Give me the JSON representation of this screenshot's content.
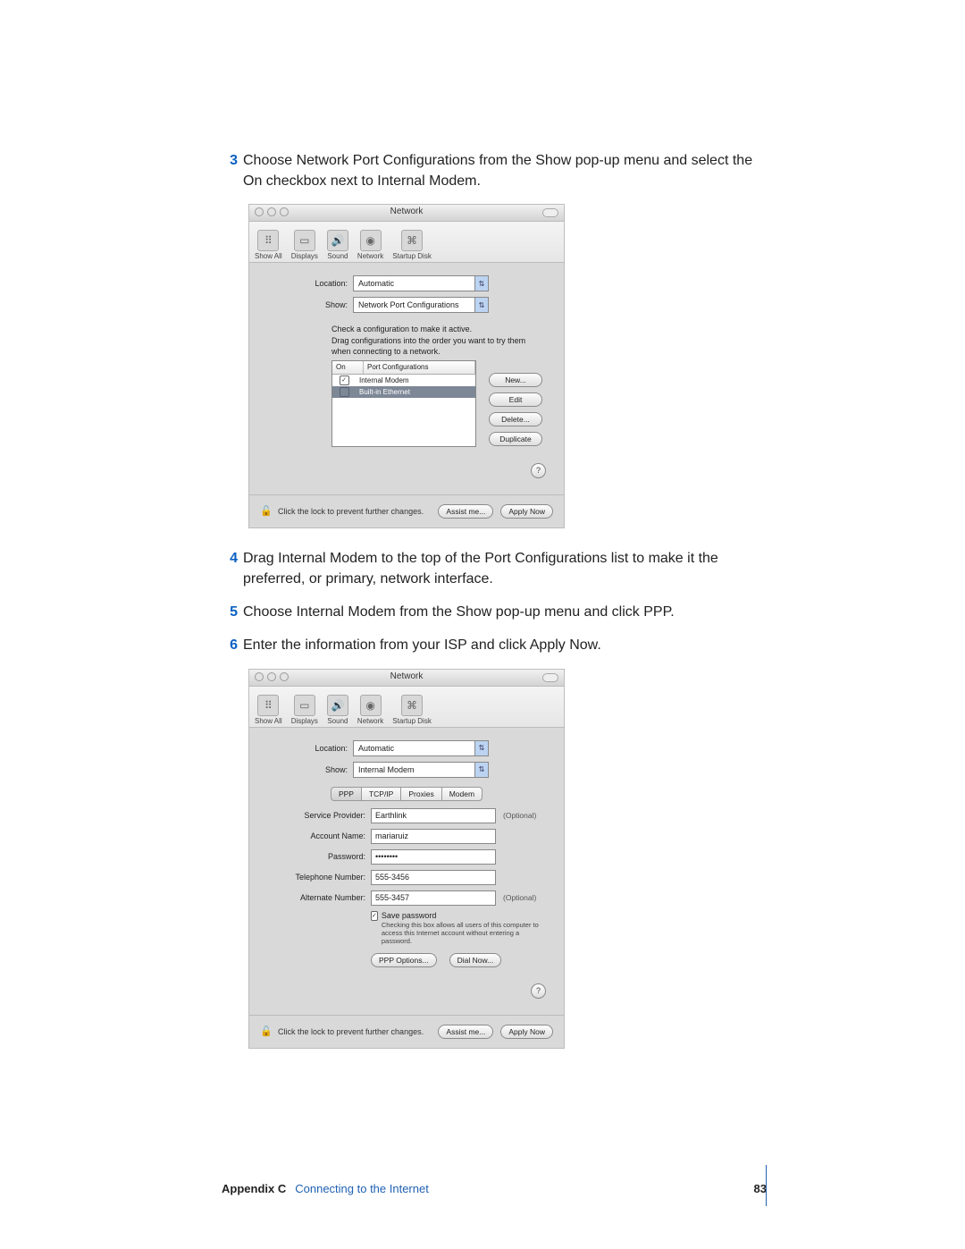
{
  "steps": {
    "s3": {
      "num": "3",
      "text": "Choose Network Port Configurations from the Show pop-up menu and select the On checkbox next to Internal Modem."
    },
    "s4": {
      "num": "4",
      "text": "Drag Internal Modem to the top of the Port Configurations list to make it the preferred, or primary, network interface."
    },
    "s5": {
      "num": "5",
      "text": "Choose Internal Modem from the Show pop-up menu and click PPP."
    },
    "s6": {
      "num": "6",
      "text": "Enter the information from your ISP and click Apply Now."
    }
  },
  "shot1": {
    "title": "Network",
    "toolbar": {
      "showall": "Show All",
      "displays": "Displays",
      "sound": "Sound",
      "network": "Network",
      "startup": "Startup Disk"
    },
    "location_label": "Location:",
    "location_value": "Automatic",
    "show_label": "Show:",
    "show_value": "Network Port Configurations",
    "instructions": "Check a configuration to make it active.\nDrag configurations into the order you want to try them when connecting to a network.",
    "col_on": "On",
    "col_pc": "Port Configurations",
    "rows": [
      {
        "on": true,
        "name": "Internal Modem",
        "selected": false
      },
      {
        "on": false,
        "name": "Built-in Ethernet",
        "selected": true
      }
    ],
    "btn_new": "New...",
    "btn_edit": "Edit",
    "btn_delete": "Delete...",
    "btn_duplicate": "Duplicate",
    "help": "?",
    "lock_text": "Click the lock to prevent further changes.",
    "assist": "Assist me...",
    "apply": "Apply Now"
  },
  "shot2": {
    "title": "Network",
    "toolbar": {
      "showall": "Show All",
      "displays": "Displays",
      "sound": "Sound",
      "network": "Network",
      "startup": "Startup Disk"
    },
    "location_label": "Location:",
    "location_value": "Automatic",
    "show_label": "Show:",
    "show_value": "Internal Modem",
    "tabs": {
      "ppp": "PPP",
      "tcpip": "TCP/IP",
      "proxies": "Proxies",
      "modem": "Modem"
    },
    "fields": {
      "sp_label": "Service Provider:",
      "sp_value": "Earthlink",
      "sp_opt": "(Optional)",
      "acct_label": "Account Name:",
      "acct_value": "mariaruiz",
      "pwd_label": "Password:",
      "pwd_value": "••••••••",
      "tel_label": "Telephone Number:",
      "tel_value": "555-3456",
      "alt_label": "Alternate Number:",
      "alt_value": "555-3457",
      "alt_opt": "(Optional)"
    },
    "save_label": "Save password",
    "save_hint": "Checking this box allows all users of this computer to access this Internet account without entering a password.",
    "ppp_options": "PPP Options...",
    "dial_now": "Dial Now...",
    "help": "?",
    "lock_text": "Click the lock to prevent further changes.",
    "assist": "Assist me...",
    "apply": "Apply Now"
  },
  "footer": {
    "appendix": "Appendix C",
    "title": "Connecting to the Internet",
    "page": "83"
  }
}
